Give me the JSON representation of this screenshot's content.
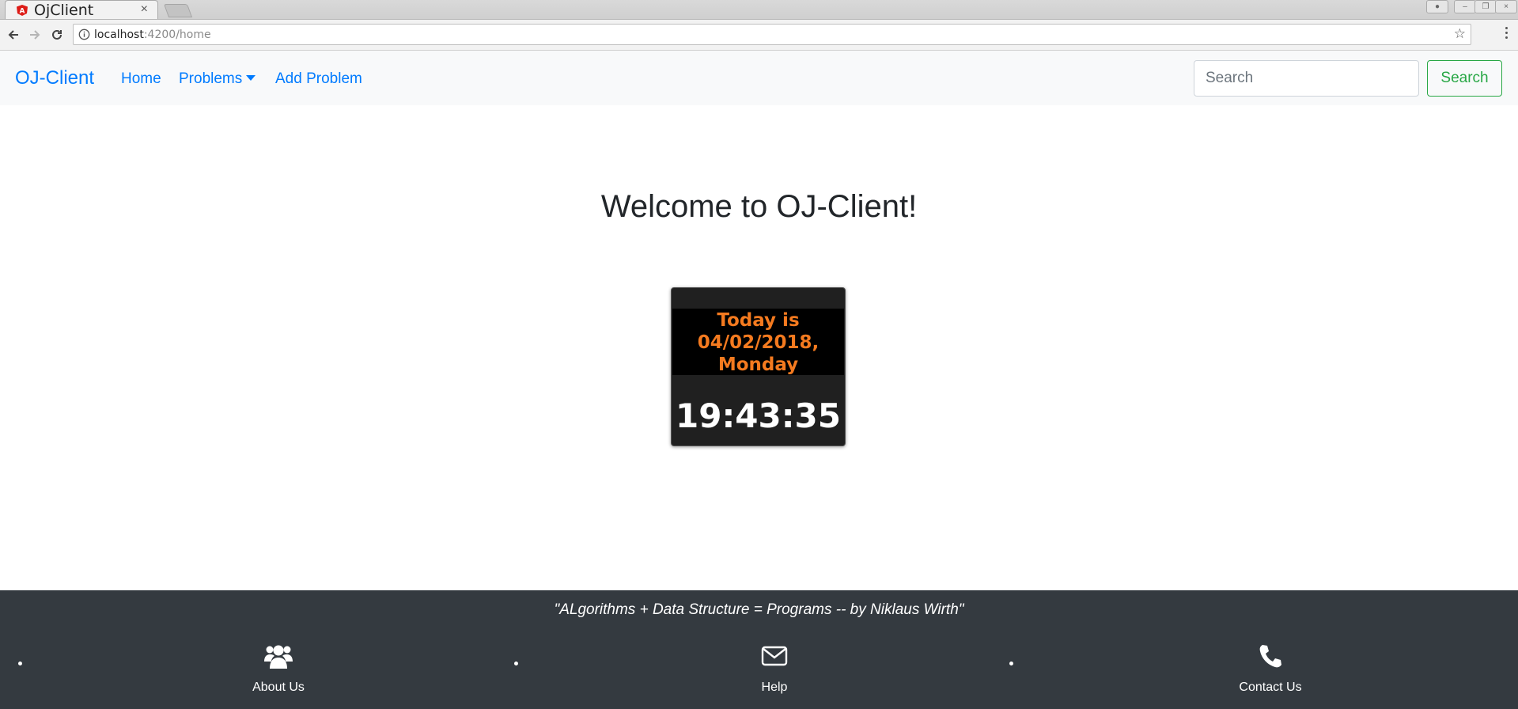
{
  "browser": {
    "tab_title": "OjClient",
    "tab_close": "×",
    "url_host": "localhost",
    "url_path": ":4200/home"
  },
  "navbar": {
    "brand": "OJ-Client",
    "links": [
      {
        "label": "Home"
      },
      {
        "label": "Problems"
      },
      {
        "label": "Add Problem"
      }
    ],
    "search_placeholder": "Search",
    "search_button": "Search"
  },
  "main": {
    "welcome": "Welcome to OJ-Client!",
    "clock": {
      "date_line1": "Today is",
      "date_line2": "04/02/2018,",
      "date_line3": "Monday",
      "time": "19:43:35"
    }
  },
  "footer": {
    "quote": "\"ALgorithms + Data Structure = Programs -- by Niklaus Wirth\"",
    "items": [
      {
        "label": "About Us",
        "icon": "users-icon"
      },
      {
        "label": "Help",
        "icon": "envelope-icon"
      },
      {
        "label": "Contact Us",
        "icon": "phone-icon"
      }
    ]
  },
  "colors": {
    "link": "#007bff",
    "success": "#28a745",
    "clock_date": "#f47a1f",
    "footer_bg": "#343a40"
  }
}
